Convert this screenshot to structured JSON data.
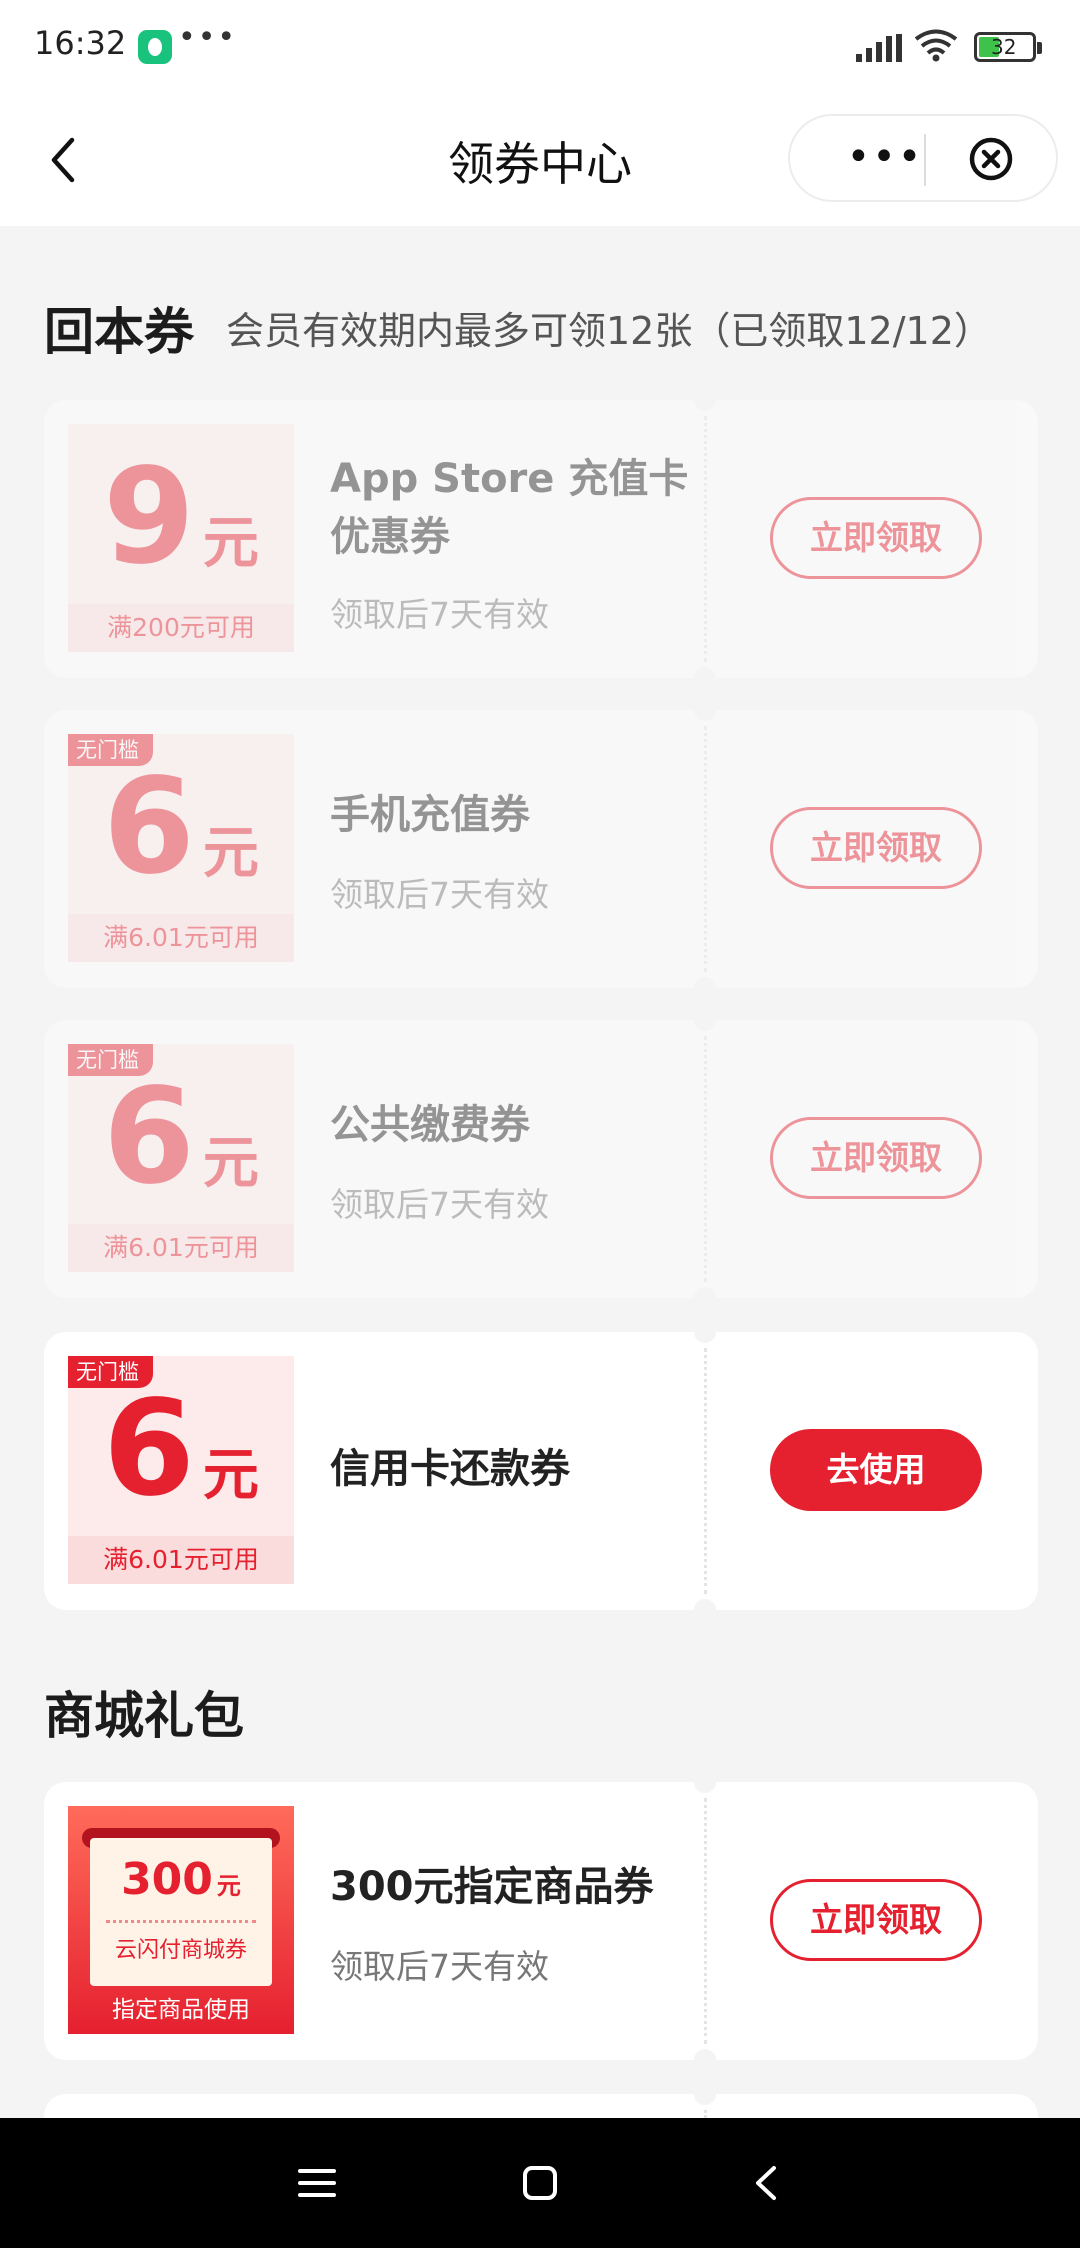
{
  "status_bar": {
    "time": "16:32",
    "notification_dots": "•••",
    "battery_level": "32",
    "icons": [
      "app-notification-icon",
      "signal-icon",
      "wifi-icon",
      "battery-icon"
    ]
  },
  "nav": {
    "title": "领券中心",
    "more_label": "•••",
    "icons": [
      "back-chevron-icon",
      "more-dots-icon",
      "close-circle-icon"
    ]
  },
  "section_huiben": {
    "title": "回本券",
    "subtitle": "会员有效期内最多可领12张（已领取12/12）",
    "coupons": [
      {
        "amount": "9",
        "unit": "元",
        "condition": "满200元可用",
        "tag": "",
        "name_line1": "App Store 充值卡",
        "name_line2": "优惠券",
        "validity": "领取后7天有效",
        "button": "立即领取",
        "state": "disabled"
      },
      {
        "amount": "6",
        "unit": "元",
        "condition": "满6.01元可用",
        "tag": "无门槛",
        "name_line1": "手机充值券",
        "name_line2": "",
        "validity": "领取后7天有效",
        "button": "立即领取",
        "state": "disabled"
      },
      {
        "amount": "6",
        "unit": "元",
        "condition": "满6.01元可用",
        "tag": "无门槛",
        "name_line1": "公共缴费券",
        "name_line2": "",
        "validity": "领取后7天有效",
        "button": "立即领取",
        "state": "disabled"
      },
      {
        "amount": "6",
        "unit": "元",
        "condition": "满6.01元可用",
        "tag": "无门槛",
        "name_line1": "信用卡还款券",
        "name_line2": "",
        "validity": "",
        "button": "去使用",
        "state": "active"
      }
    ]
  },
  "section_mall": {
    "title": "商城礼包",
    "items": [
      {
        "img_amount": "300",
        "img_unit": "元",
        "img_sub": "云闪付商城券",
        "img_foot": "指定商品使用",
        "name": "300元指定商品券",
        "validity": "领取后7天有效",
        "button": "立即领取"
      }
    ]
  },
  "system_nav": {
    "icons": [
      "menu-icon",
      "home-square-icon",
      "back-icon"
    ]
  },
  "colors": {
    "accent": "#e5202f",
    "stub_bg": "#fdeaea",
    "page_bg": "#f4f4f4"
  }
}
